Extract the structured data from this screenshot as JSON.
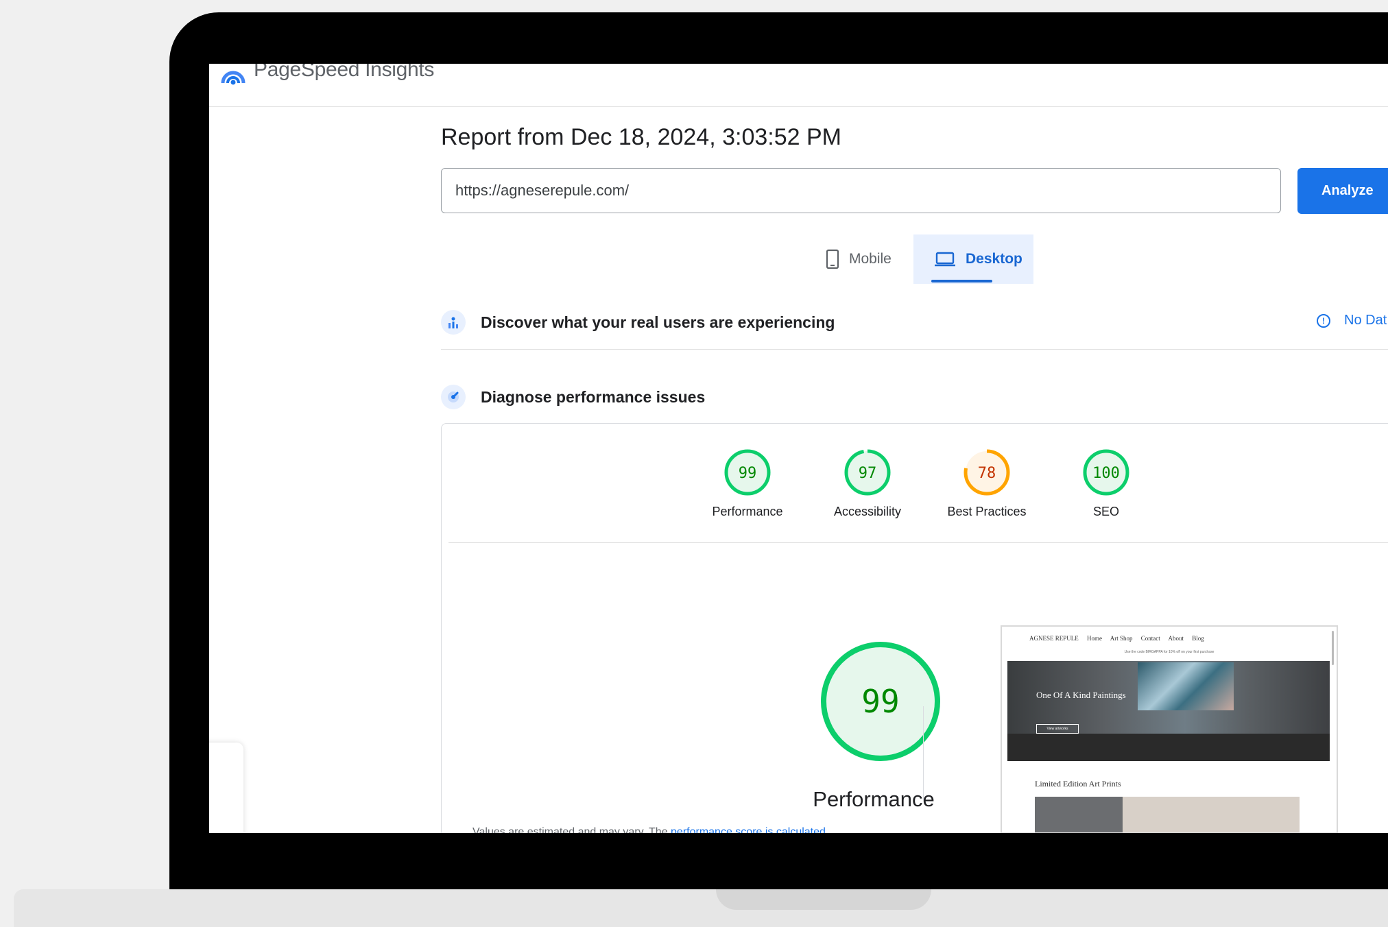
{
  "app": {
    "name": "PageSpeed Insights"
  },
  "report": {
    "title": "Report from Dec 18, 2024, 3:03:52 PM",
    "url_value": "https://agneserepule.com/",
    "analyze_label": "Analyze"
  },
  "tabs": [
    {
      "label": "Mobile",
      "selected": false
    },
    {
      "label": "Desktop",
      "selected": true
    }
  ],
  "sections": {
    "real_users": {
      "title": "Discover what your real users are experiencing",
      "status": "No Dat"
    },
    "diagnose": {
      "title": "Diagnose performance issues"
    }
  },
  "scores": [
    {
      "label": "Performance",
      "value": "99",
      "color": "#0cce6b"
    },
    {
      "label": "Accessibility",
      "value": "97",
      "color": "#0cce6b"
    },
    {
      "label": "Best Practices",
      "value": "78",
      "color": "#ffa400"
    },
    {
      "label": "SEO",
      "value": "100",
      "color": "#0cce6b"
    }
  ],
  "main_score": {
    "value": "99",
    "label": "Performance",
    "note": "Values are estimated and may vary. The ",
    "link": "performance score is calculated"
  },
  "screenshot": {
    "brand": "AGNESE REPULE",
    "nav": [
      "Home",
      "Art Shop",
      "Contact",
      "About",
      "Blog"
    ],
    "banner": "Use the code BIRGAPPA for 10% off on your first purchase",
    "hero_title": "One Of A Kind Paintings",
    "hero_button": "View artworks",
    "section_title": "Limited Edition Art Prints"
  },
  "colors": {
    "accent": "#1a73e8",
    "pass": "#0cce6b",
    "average": "#ffa400"
  }
}
